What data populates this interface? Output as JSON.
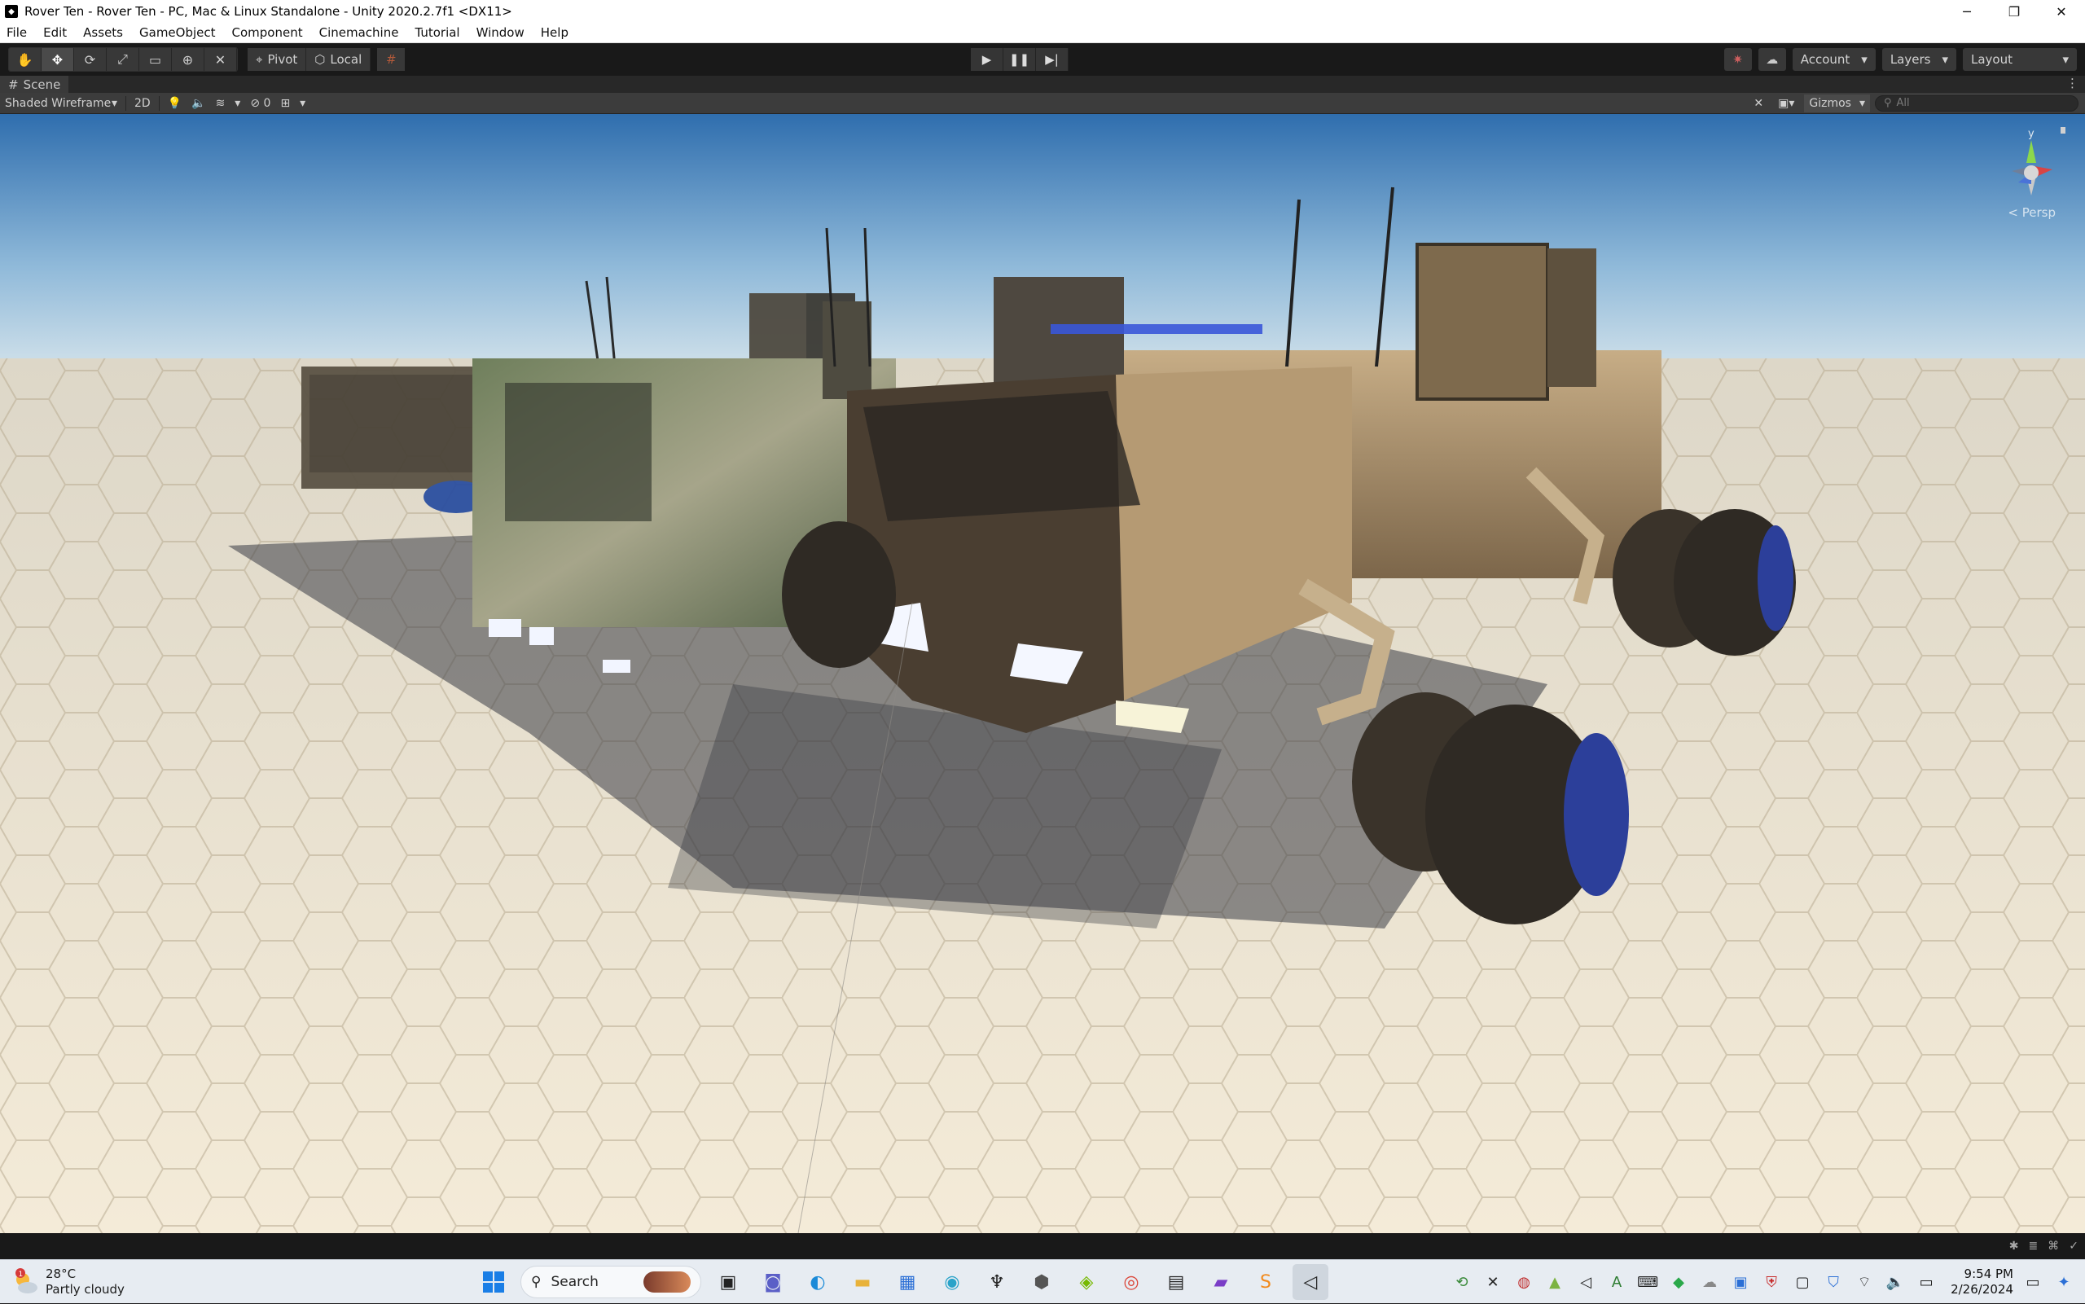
{
  "window": {
    "title": "Rover Ten - Rover Ten - PC, Mac & Linux Standalone - Unity 2020.2.7f1 <DX11>",
    "minimize": "─",
    "maximize": "❐",
    "close": "✕"
  },
  "menu": [
    "File",
    "Edit",
    "Assets",
    "GameObject",
    "Component",
    "Cinemachine",
    "Tutorial",
    "Window",
    "Help"
  ],
  "toolbar": {
    "pivot_label": "Pivot",
    "local_label": "Local",
    "account_label": "Account",
    "layers_label": "Layers",
    "layout_label": "Layout"
  },
  "scene_tab": {
    "label": "Scene"
  },
  "scene_toolbar": {
    "draw_mode": "Shaded Wireframe",
    "mode_2d": "2D",
    "hidden_count": "0",
    "gizmos_label": "Gizmos",
    "search_placeholder": "All"
  },
  "view_gizmo": {
    "axis_y": "y",
    "projection": "< Persp"
  },
  "taskbar": {
    "temperature": "28°C",
    "weather": "Partly cloudy",
    "weather_badge": "1",
    "search_label": "Search",
    "time": "9:54 PM",
    "date": "2/26/2024"
  },
  "colors": {
    "editor_bg": "#191919",
    "sky_top": "#3a78b8",
    "ground": "#efe6d2",
    "taskbar_bg": "#e7ecf2"
  }
}
